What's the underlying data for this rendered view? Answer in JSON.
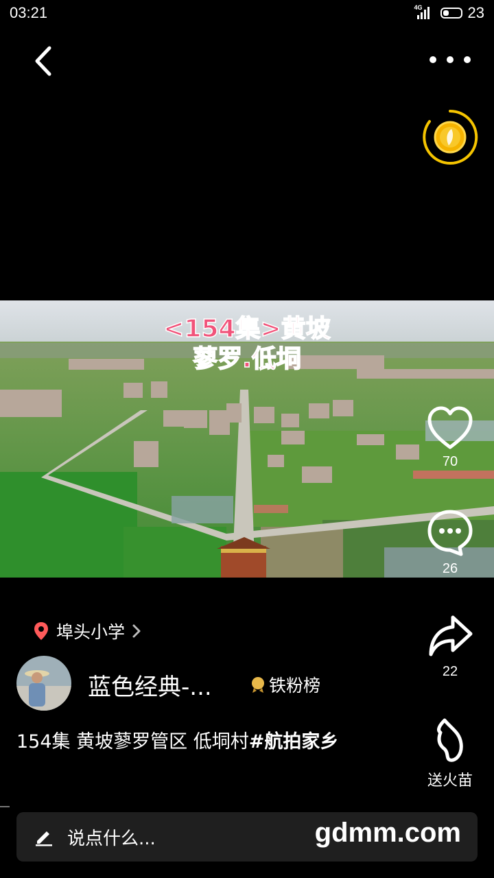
{
  "status_bar": {
    "time": "03:21",
    "network": "4G",
    "battery": "23"
  },
  "video": {
    "caption_line1": "<154集>黄坡",
    "caption_line2": "蓼罗.低垌"
  },
  "actions": {
    "like_count": "70",
    "comment_count": "26",
    "share_count": "22",
    "gift_label": "送火苗"
  },
  "location": {
    "name": "埠头小学"
  },
  "author": {
    "name": "蓝色经典-...",
    "fan_rank_label": "铁粉榜"
  },
  "description": {
    "text": "154集 黄坡蓼罗管区 低垌村",
    "hashtag": "#航拍家乡"
  },
  "comment_bar": {
    "placeholder": "说点什么...",
    "watermark": "gdmm.com"
  },
  "colors": {
    "accent_gold": "#f5c400",
    "caption_pink": "#f1537a",
    "pin_red": "#ff5a5a"
  }
}
